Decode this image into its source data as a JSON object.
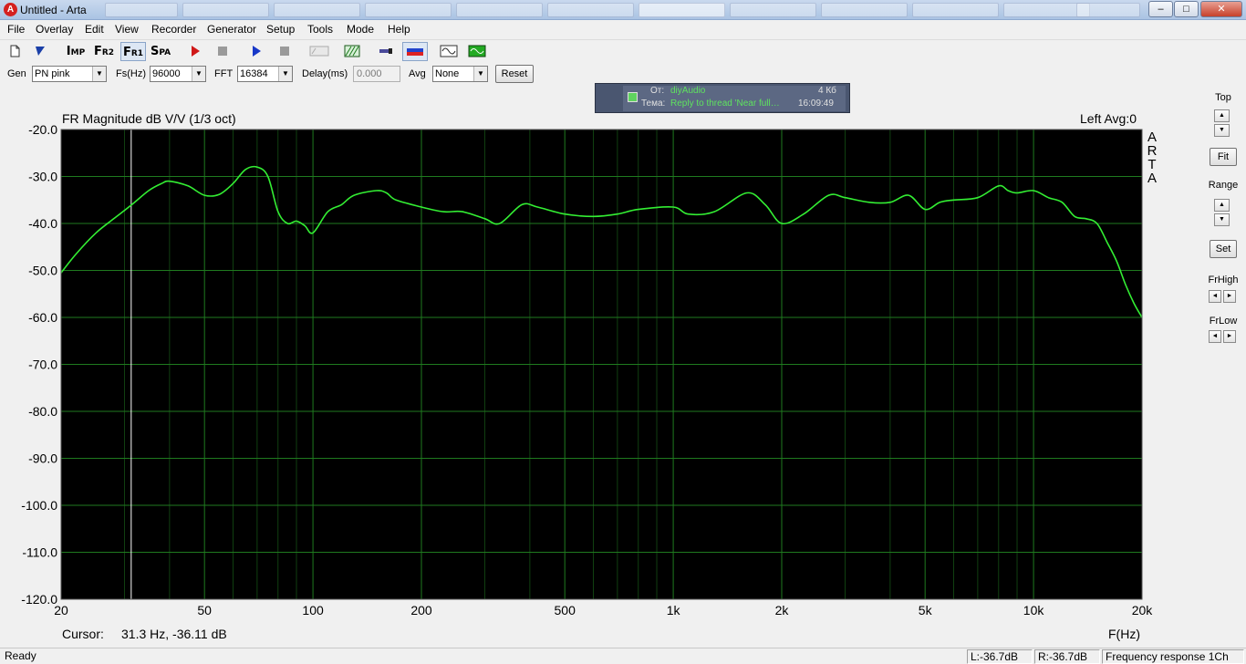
{
  "window": {
    "title": "Untitled - Arta",
    "app_icon_glyph": "A",
    "controls": [
      "–",
      "□",
      "✕"
    ]
  },
  "menu": [
    "File",
    "Overlay",
    "Edit",
    "View",
    "Recorder",
    "Generator",
    "Setup",
    "Tools",
    "Mode",
    "Help"
  ],
  "toolbar": {
    "imp": {
      "big": "I",
      "small": "MP"
    },
    "fr2": {
      "big": "F",
      "small": "R2"
    },
    "fr1": {
      "big": "F",
      "small": "R1"
    },
    "spa": {
      "big": "S",
      "small": "PA"
    }
  },
  "controls": {
    "gen_label": "Gen",
    "gen_value": "PN pink",
    "fs_label": "Fs(Hz)",
    "fs_value": "96000",
    "fft_label": "FFT",
    "fft_value": "16384",
    "delay_label": "Delay(ms)",
    "delay_value": "0.000",
    "avg_label": "Avg",
    "avg_value": "None",
    "reset_label": "Reset"
  },
  "notification": {
    "from_label": "От:",
    "from_value": "diyAudio",
    "size": "4 Кб",
    "subject_label": "Тема:",
    "subject_value": "Reply to thread 'Near full…",
    "time": "16:09:49"
  },
  "plot": {
    "title": "FR Magnitude dB V/V (1/3 oct)",
    "status_right": "Left  Avg:0",
    "brand_vertical": [
      "A",
      "R",
      "T",
      "A"
    ],
    "cursor_label": "Cursor:",
    "cursor_value": "31.3 Hz, -36.11 dB",
    "xaxis_label": "F(Hz)",
    "colors": {
      "background": "#000000",
      "grid": "#1f7a1f",
      "trace": "#33ee33",
      "cursor": "#ffffff"
    }
  },
  "chart_data": {
    "type": "line",
    "title": "FR Magnitude dB V/V (1/3 oct)",
    "xlabel": "F(Hz)",
    "ylabel": "",
    "x_scale": "log",
    "xlim": [
      20,
      20000
    ],
    "ylim": [
      -120,
      -20
    ],
    "grid": true,
    "x_ticks": [
      {
        "value": 20,
        "label": "20"
      },
      {
        "value": 50,
        "label": "50"
      },
      {
        "value": 100,
        "label": "100"
      },
      {
        "value": 200,
        "label": "200"
      },
      {
        "value": 500,
        "label": "500"
      },
      {
        "value": 1000,
        "label": "1k"
      },
      {
        "value": 2000,
        "label": "2k"
      },
      {
        "value": 5000,
        "label": "5k"
      },
      {
        "value": 10000,
        "label": "10k"
      },
      {
        "value": 20000,
        "label": "20k"
      }
    ],
    "y_ticks": [
      {
        "value": -20,
        "label": "-20.0"
      },
      {
        "value": -30,
        "label": "-30.0"
      },
      {
        "value": -40,
        "label": "-40.0"
      },
      {
        "value": -50,
        "label": "-50.0"
      },
      {
        "value": -60,
        "label": "-60.0"
      },
      {
        "value": -70,
        "label": "-70.0"
      },
      {
        "value": -80,
        "label": "-80.0"
      },
      {
        "value": -90,
        "label": "-90.0"
      },
      {
        "value": -100,
        "label": "-100.0"
      },
      {
        "value": -110,
        "label": "-110.0"
      },
      {
        "value": -120,
        "label": "-120.0"
      }
    ],
    "cursor_x": 31.3,
    "series": [
      {
        "x": [
          20,
          22,
          25,
          28,
          31.3,
          35,
          38,
          40,
          45,
          50,
          55,
          60,
          65,
          70,
          75,
          80,
          85,
          90,
          95,
          100,
          110,
          120,
          130,
          150,
          160,
          170,
          200,
          230,
          260,
          300,
          330,
          380,
          420,
          500,
          600,
          700,
          800,
          1000,
          1100,
          1300,
          1600,
          1800,
          2000,
          2300,
          2700,
          3000,
          3500,
          4000,
          4500,
          5000,
          5500,
          6000,
          7000,
          8000,
          8500,
          9000,
          10000,
          11000,
          12000,
          13000,
          14000,
          15000,
          16000,
          17000,
          18000,
          19000,
          20000
        ],
        "y": [
          -50.5,
          -46.5,
          -42,
          -39,
          -36.1,
          -33,
          -31.5,
          -31,
          -32,
          -34,
          -33.8,
          -31.5,
          -28.5,
          -28,
          -30,
          -37.5,
          -40,
          -39.5,
          -40.5,
          -42,
          -37.5,
          -36,
          -34,
          -33,
          -33.5,
          -35,
          -36.5,
          -37.5,
          -37.5,
          -39,
          -40,
          -36,
          -36.5,
          -38,
          -38.5,
          -38,
          -37,
          -36.5,
          -38,
          -37.5,
          -33.5,
          -36,
          -40,
          -38,
          -34,
          -34.5,
          -35.5,
          -35.5,
          -34,
          -37,
          -35.5,
          -35,
          -34.5,
          -32,
          -33,
          -33.5,
          -33,
          -34.5,
          -35.5,
          -38.5,
          -39,
          -40,
          -44,
          -48,
          -53,
          -57,
          -60
        ]
      }
    ]
  },
  "right_panel": {
    "top_label": "Top",
    "fit_label": "Fit",
    "range_label": "Range",
    "set_label": "Set",
    "frhigh_label": "FrHigh",
    "frlow_label": "FrLow"
  },
  "status": {
    "ready": "Ready",
    "left_level": "L:-36.7dB",
    "right_level": "R:-36.7dB",
    "mode": "Frequency response 1Ch"
  }
}
